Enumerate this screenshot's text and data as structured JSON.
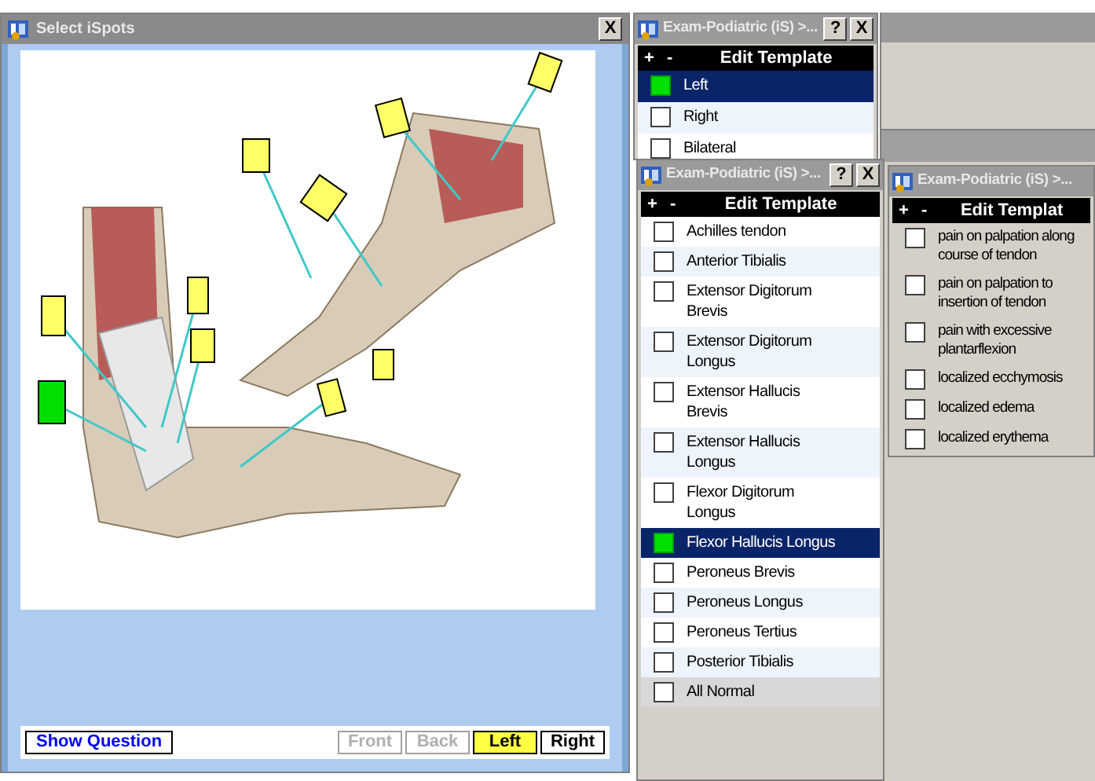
{
  "ispots_window": {
    "title": "Select iSpots",
    "close": "X",
    "spots": [
      {
        "selected": false
      },
      {
        "selected": false
      },
      {
        "selected": false
      },
      {
        "selected": false
      },
      {
        "selected": false
      },
      {
        "selected": false
      },
      {
        "selected": false
      },
      {
        "selected": true
      },
      {
        "selected": false
      },
      {
        "selected": false
      }
    ],
    "show_question": "Show Question",
    "view_buttons": [
      {
        "label": "Front",
        "disabled": true,
        "selected": false
      },
      {
        "label": "Back",
        "disabled": true,
        "selected": false
      },
      {
        "label": "Left",
        "disabled": false,
        "selected": true
      },
      {
        "label": "Right",
        "disabled": false,
        "selected": false
      }
    ]
  },
  "template_windows": [
    {
      "title": "Exam-Podiatric (iS) >...",
      "help": "?",
      "close": "X",
      "header_plus": "+",
      "header_minus": "-",
      "header": "Edit Template",
      "items": [
        {
          "label": "Left",
          "checked": true,
          "selected": true,
          "kind": "item"
        },
        {
          "label": "Right",
          "checked": false,
          "selected": false,
          "kind": "item"
        },
        {
          "label": "Bilateral",
          "checked": false,
          "selected": false,
          "kind": "item"
        }
      ]
    },
    {
      "title": "Exam-Podiatric (iS) >...",
      "help": "?",
      "close": "X",
      "header_plus": "+",
      "header_minus": "-",
      "header": "Edit Template",
      "items": [
        {
          "label": "Achilles tendon",
          "checked": false,
          "selected": false,
          "kind": "item"
        },
        {
          "label": "Anterior Tibialis",
          "checked": false,
          "selected": false,
          "kind": "item"
        },
        {
          "label": "Extensor Digitorum Brevis",
          "checked": false,
          "selected": false,
          "kind": "item"
        },
        {
          "label": "Extensor Digitorum Longus",
          "checked": false,
          "selected": false,
          "kind": "item"
        },
        {
          "label": "Extensor Hallucis Brevis",
          "checked": false,
          "selected": false,
          "kind": "item"
        },
        {
          "label": "Extensor Hallucis Longus",
          "checked": false,
          "selected": false,
          "kind": "item"
        },
        {
          "label": "Flexor Digitorum Longus",
          "checked": false,
          "selected": false,
          "kind": "item"
        },
        {
          "label": "Flexor Hallucis Longus",
          "checked": true,
          "selected": true,
          "kind": "item"
        },
        {
          "label": "Peroneus Brevis",
          "checked": false,
          "selected": false,
          "kind": "item"
        },
        {
          "label": "Peroneus Longus",
          "checked": false,
          "selected": false,
          "kind": "item"
        },
        {
          "label": "Peroneus Tertius",
          "checked": false,
          "selected": false,
          "kind": "item"
        },
        {
          "label": "Posterior Tibialis",
          "checked": false,
          "selected": false,
          "kind": "item"
        },
        {
          "label": "All Normal",
          "checked": false,
          "selected": false,
          "kind": "normal"
        }
      ]
    },
    {
      "title": "Exam-Podiatric (iS) >...",
      "header_plus": "+",
      "header_minus": "-",
      "header": "Edit Templat",
      "items": [
        {
          "label": "pain on palpation along course of tendon",
          "checked": false,
          "selected": false,
          "kind": "item"
        },
        {
          "label": "pain on palpation to insertion of tendon",
          "checked": false,
          "selected": false,
          "kind": "item"
        },
        {
          "label": "pain with excessive plantarflexion",
          "checked": false,
          "selected": false,
          "kind": "item"
        },
        {
          "label": "localized ecchymosis",
          "checked": false,
          "selected": false,
          "kind": "item"
        },
        {
          "label": "localized edema",
          "checked": false,
          "selected": false,
          "kind": "item"
        },
        {
          "label": "localized erythema",
          "checked": false,
          "selected": false,
          "kind": "item"
        }
      ]
    }
  ]
}
